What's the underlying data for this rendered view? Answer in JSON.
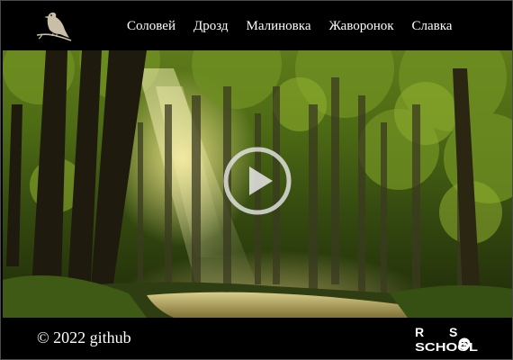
{
  "header": {
    "logo_icon": "bird-icon",
    "nav": [
      {
        "label": "Соловей"
      },
      {
        "label": "Дрозд"
      },
      {
        "label": "Малиновка"
      },
      {
        "label": "Жаворонок"
      },
      {
        "label": "Славка"
      }
    ]
  },
  "main": {
    "play_icon": "play-icon"
  },
  "footer": {
    "copyright": "© 2022 github",
    "logo": {
      "r": "R",
      "s": "S",
      "num": "19",
      "school": "SCHOOL"
    }
  }
}
